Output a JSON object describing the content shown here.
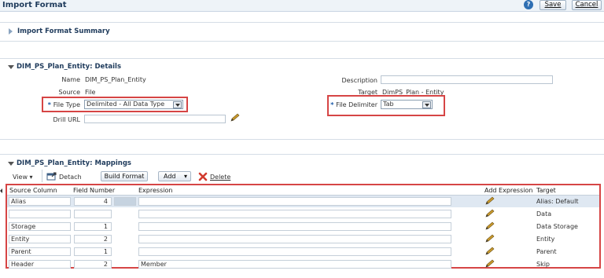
{
  "header": {
    "title": "Import Format",
    "save_label": "Save",
    "cancel_label": "Cancel"
  },
  "summary": {
    "title": "Import Format Summary"
  },
  "details": {
    "title": "DIM_PS_Plan_Entity: Details",
    "name_label": "Name",
    "name_value": "DIM_PS_Plan_Entity",
    "source_label": "Source",
    "source_value": "File",
    "file_type_label": "File Type",
    "file_type_value": "Delimited - All Data Type",
    "drill_url_label": "Drill URL",
    "description_label": "Description",
    "target_label": "Target",
    "target_value": "DimPS_Plan - Entity",
    "file_delimiter_label": "File Delimiter",
    "file_delimiter_value": "Tab"
  },
  "mappings": {
    "title": "DIM_PS_Plan_Entity: Mappings",
    "toolbar": {
      "view_label": "View",
      "detach_label": "Detach",
      "build_format_label": "Build Format",
      "add_label": "Add",
      "delete_label": "Delete"
    },
    "columns": [
      "Source Column",
      "Field Number",
      "Expression",
      "Add Expression",
      "Target"
    ],
    "rows": [
      {
        "source": "Alias",
        "field": "4",
        "expression": "",
        "target": "Alias: Default"
      },
      {
        "source": "",
        "field": "",
        "expression": "",
        "target": "Data"
      },
      {
        "source": "Storage",
        "field": "1",
        "expression": "",
        "target": "Data Storage"
      },
      {
        "source": "Entity",
        "field": "2",
        "expression": "",
        "target": "Entity"
      },
      {
        "source": "Parent",
        "field": "1",
        "expression": "",
        "target": "Parent"
      },
      {
        "source": "Header",
        "field": "2",
        "expression": "Member",
        "target": "Skip"
      }
    ]
  },
  "colors": {
    "highlight_red": "#d64545",
    "header_text": "#1f3b5c",
    "help_blue": "#2f6fb3"
  }
}
